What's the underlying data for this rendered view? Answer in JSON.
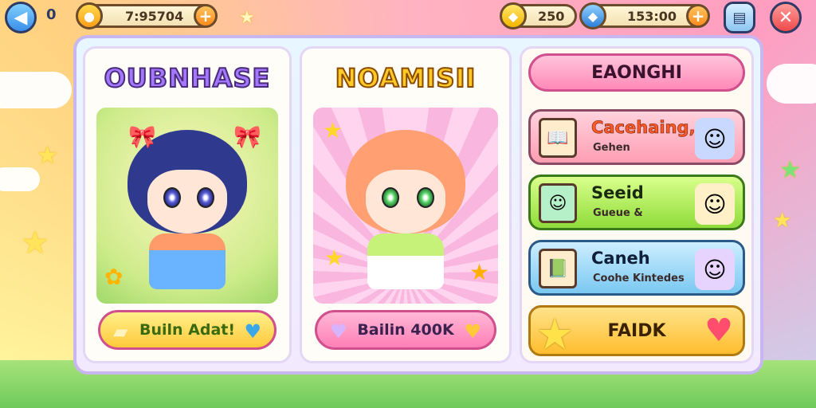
{
  "hud": {
    "back_count": "0",
    "gold_value": "7:95704",
    "gems_value": "250",
    "energy_value": "153:00",
    "plus_label": "+"
  },
  "cards": [
    {
      "title": "OUBNHASE",
      "button_label": "Builn Adat!"
    },
    {
      "title": "NOAMISII",
      "button_label": "Bailin 400K"
    }
  ],
  "menu": {
    "header": "EAONGHI",
    "items": [
      {
        "title": "Cacehaing,",
        "subtitle": "Gehen"
      },
      {
        "title": "Seeid",
        "subtitle": "Gueue &"
      },
      {
        "title": "Caneh",
        "subtitle": "Coohe Kintedes"
      }
    ],
    "faq_label": "FAIDK"
  },
  "colors": {
    "accent_pink": "#ff7fb6",
    "accent_yellow": "#ffbd2e",
    "accent_green": "#8fdc3a",
    "accent_blue": "#7ac8f2"
  },
  "icons": {
    "back": "arrow-left-icon",
    "gold": "gold-coin-icon",
    "gem": "blue-gem-icon",
    "save": "save-icon",
    "close": "close-icon"
  }
}
